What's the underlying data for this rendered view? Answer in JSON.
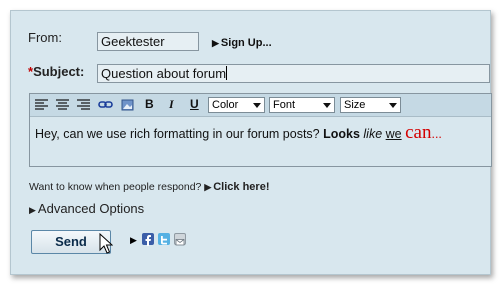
{
  "form": {
    "from_label": "From:",
    "from_value": "Geektester",
    "signup_link": "Sign Up...",
    "subject_required": "*",
    "subject_label": "Subject:",
    "subject_value": "Question about forum"
  },
  "toolbar": {
    "bold": "B",
    "italic": "I",
    "underline": "U",
    "color_select": "Color",
    "font_select": "Font",
    "size_select": "Size"
  },
  "editor": {
    "text_plain": "Hey, can we use rich formatting in our forum posts?  ",
    "text_bold": "Looks",
    "text_italic": "like",
    "text_underline": "we",
    "text_big_red": "can",
    "text_ellipsis": "...",
    "big_red_color": "#d40000"
  },
  "notify": {
    "prompt": "Want to know when people respond?",
    "link": "Click here!"
  },
  "advanced": {
    "label": "Advanced Options"
  },
  "actions": {
    "send_label": "Send"
  },
  "share": {
    "icons": [
      "facebook-icon",
      "twitter-icon",
      "email-icon"
    ]
  }
}
